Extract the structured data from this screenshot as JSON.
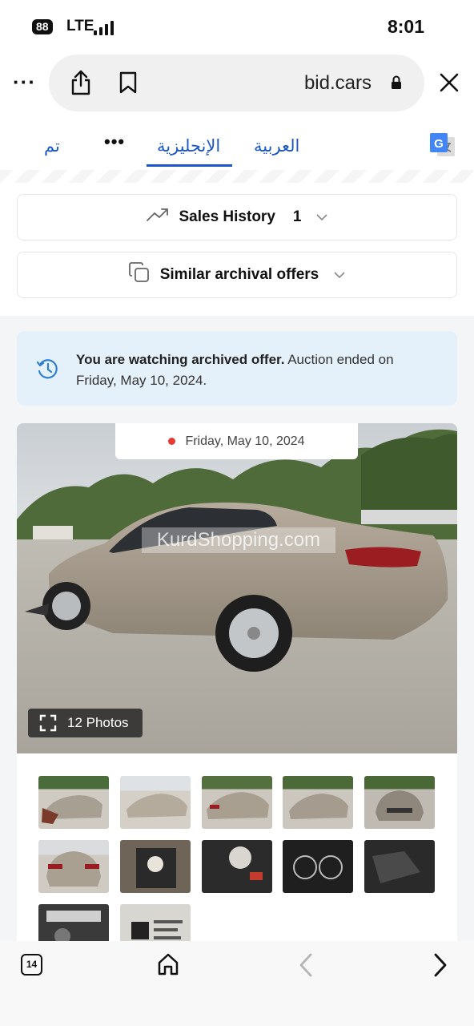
{
  "status_bar": {
    "battery": "88",
    "network": "LTE",
    "time": "8:01"
  },
  "browser": {
    "domain": "bid.cars",
    "more_icon": "ellipsis-icon",
    "share_icon": "share-icon",
    "bookmark_icon": "bookmark-icon",
    "lock_icon": "lock-icon",
    "close_icon": "close-icon"
  },
  "translate_bar": {
    "done": "تم",
    "more": "•••",
    "english": "الإنجليزية",
    "arabic": "العربية",
    "translate_icon": "google-translate-icon"
  },
  "sales_history": {
    "label": "Sales History",
    "count": "1",
    "icon": "trending-up-icon"
  },
  "similar_offers": {
    "label": "Similar archival offers",
    "icon": "copy-icon"
  },
  "archive_notice": {
    "bold": "You are watching archived offer.",
    "rest": " Auction ended on Friday, May 10, 2024."
  },
  "photo": {
    "date": "Friday, May 10, 2024",
    "watermark": "KurdShopping.com",
    "photos_label": "12 Photos",
    "accent_red": "#e53935"
  },
  "thumbnails": [
    "front-left damaged",
    "rear-left",
    "left side",
    "front-left",
    "front",
    "rear",
    "interior front",
    "airbag",
    "instrument cluster",
    "rear seats",
    "engine bay",
    "window sticker"
  ],
  "bottom_bar": {
    "tabs_count": "14",
    "home_icon": "home-icon",
    "back_icon": "back-arrow-icon",
    "forward_icon": "forward-arrow-icon"
  }
}
